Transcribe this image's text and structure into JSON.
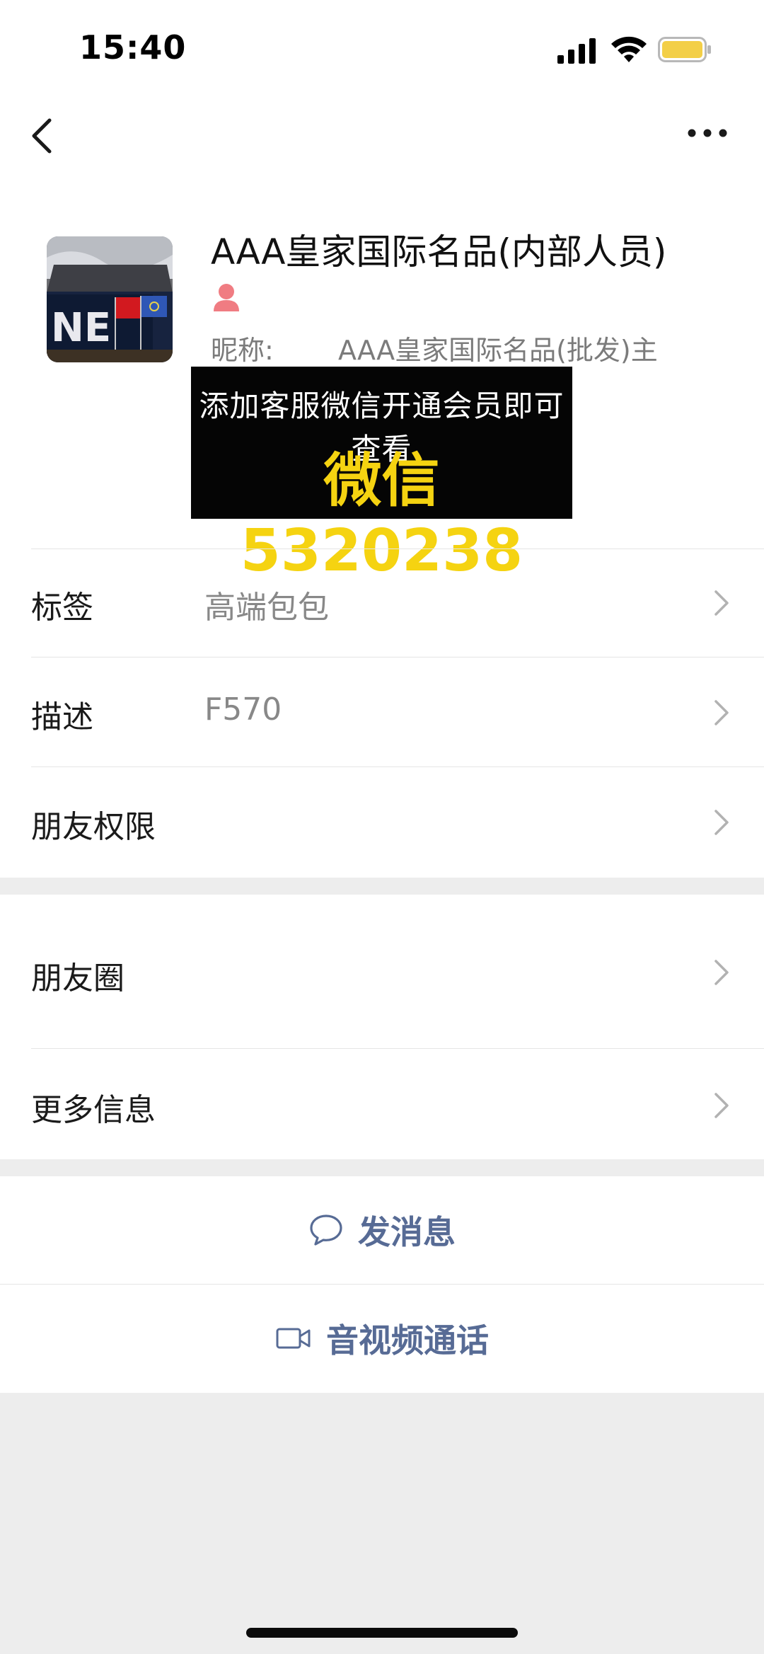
{
  "status_bar": {
    "time": "15:40"
  },
  "profile": {
    "name": "AAA皇家国际名品(内部人员)",
    "nickname_label": "昵称:",
    "nickname_value": "AAA皇家国际名品(批发)主"
  },
  "promo_banner": {
    "line1": "添加客服微信开通会员即可查看",
    "line2": "微信5320238"
  },
  "rows": {
    "tags_label": "标签",
    "tags_value": "高端包包",
    "description_label": "描述",
    "description_value": "F570",
    "permissions_label": "朋友权限",
    "moments_label": "朋友圈",
    "more_info_label": "更多信息"
  },
  "actions": {
    "send_message": "发消息",
    "av_call": "音视频通话"
  },
  "colors": {
    "link_blue": "#576b95",
    "promo_yellow": "#f5d311",
    "gender_female": "#f07c82",
    "battery_yellow": "#f3cf47"
  },
  "icons": {
    "back": "back-arrow-icon",
    "more": "more-dots-icon",
    "gender": "female-gender-icon",
    "message": "chat-bubble-icon",
    "video": "video-camera-icon",
    "chevron": "chevron-right-icon"
  }
}
